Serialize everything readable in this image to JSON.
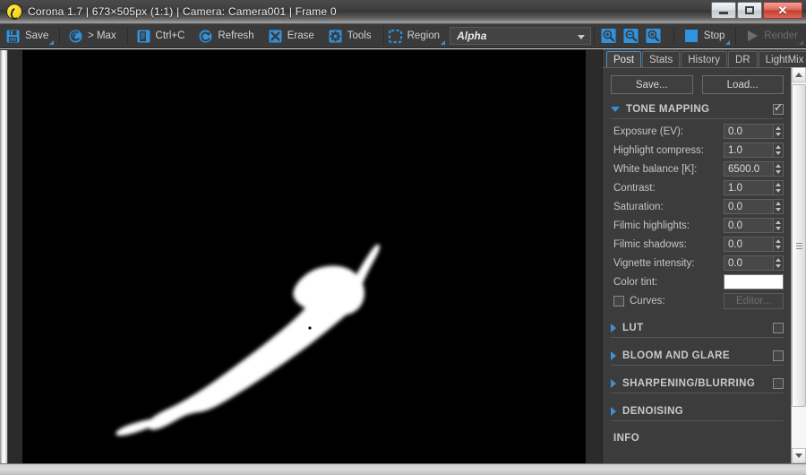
{
  "window": {
    "title": "Corona 1.7 | 673×505px (1:1) | Camera: Camera001 | Frame 0",
    "logo_icon": "corona-logo-icon",
    "minimize_label": "",
    "maximize_label": "",
    "close_label": "✕"
  },
  "toolbar": {
    "buttons": [
      {
        "label": "Save",
        "icon": "save-disk-icon"
      },
      {
        "label": "> Max",
        "icon": "corona-swirl-icon"
      },
      {
        "label": "Ctrl+C",
        "icon": "copy-icon"
      },
      {
        "label": "Refresh",
        "icon": "refresh-icon"
      },
      {
        "label": "Erase",
        "icon": "erase-x-icon"
      },
      {
        "label": "Tools",
        "icon": "gear-icon"
      },
      {
        "label": "Region",
        "icon": "region-marquee-icon"
      }
    ],
    "region_value": "Alpha",
    "zoom_in_icon": "zoom-in-icon",
    "zoom_out_icon": "zoom-out-icon",
    "zoom_reset_icon": "zoom-reset-icon",
    "stop_label": "Stop",
    "stop_icon": "stop-square-icon",
    "render_label": "Render",
    "render_icon": "play-triangle-icon"
  },
  "panel": {
    "tabs": [
      {
        "label": "Post",
        "active": true
      },
      {
        "label": "Stats",
        "active": false
      },
      {
        "label": "History",
        "active": false
      },
      {
        "label": "DR",
        "active": false
      },
      {
        "label": "LightMix",
        "active": false
      }
    ],
    "save_label": "Save...",
    "load_label": "Load...",
    "tone_mapping": {
      "title": "TONE MAPPING",
      "enabled": true,
      "fields": [
        {
          "label": "Exposure (EV):",
          "value": "0.0"
        },
        {
          "label": "Highlight compress:",
          "value": "1.0"
        },
        {
          "label": "White balance [K]:",
          "value": "6500.0"
        },
        {
          "label": "Contrast:",
          "value": "1.0"
        },
        {
          "label": "Saturation:",
          "value": "0.0"
        },
        {
          "label": "Filmic highlights:",
          "value": "0.0"
        },
        {
          "label": "Filmic shadows:",
          "value": "0.0"
        },
        {
          "label": "Vignette intensity:",
          "value": "0.0"
        }
      ],
      "color_tint_label": "Color tint:",
      "color_tint_value": "#ffffff",
      "curves_label": "Curves:",
      "curves_enabled": false,
      "curves_button": "Editor..."
    },
    "collapsed_sections": [
      {
        "title": "LUT",
        "has_checkbox": true,
        "checked": false
      },
      {
        "title": "BLOOM AND GLARE",
        "has_checkbox": true,
        "checked": false
      },
      {
        "title": "SHARPENING/BLURRING",
        "has_checkbox": true,
        "checked": false
      },
      {
        "title": "DENOISING",
        "has_checkbox": false,
        "checked": false
      }
    ],
    "info_title": "INFO"
  },
  "viewport": {
    "name": "render-viewport",
    "background": "#000000",
    "content": "alpha-matte-white-silhouette"
  },
  "colors": {
    "accent_blue": "#3d8fd4",
    "toolbar_bg": "#3a3a3a",
    "panel_bg": "#3c3c3c",
    "text": "#c9c9c9"
  }
}
